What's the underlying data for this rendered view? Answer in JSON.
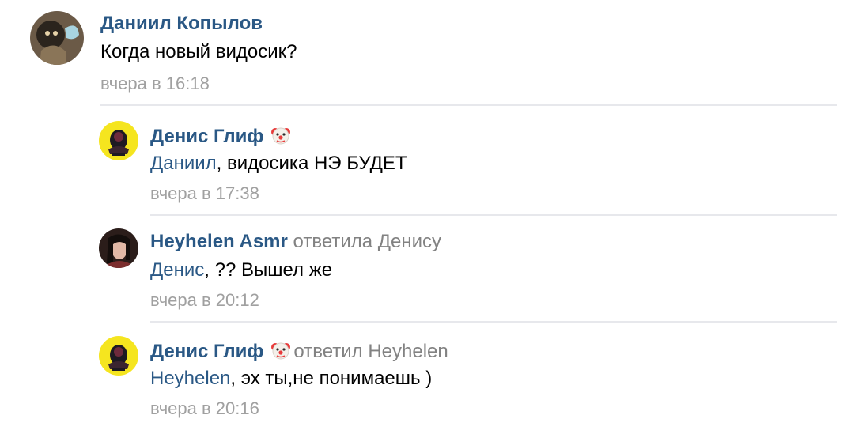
{
  "comments": [
    {
      "author": "Даниил Копылов",
      "reply_to": "",
      "mention": "",
      "text": "Когда новый видосик?",
      "date": "вчера в 16:18"
    },
    {
      "author": "Денис Глиф",
      "reply_to": "",
      "mention": "Даниил",
      "text": ", видосика НЭ БУДЕТ",
      "date": "вчера в 17:38"
    },
    {
      "author": "Heyhelen Asmr",
      "reply_to": "ответила Денису",
      "mention": "Денис",
      "text": ", ?? Вышел же",
      "date": "вчера в 20:12"
    },
    {
      "author": "Денис Глиф",
      "reply_to": "ответил Heyhelen",
      "mention": "Heyhelen",
      "text": ", эх ты,не понимаешь )",
      "date": "вчера в 20:16"
    }
  ],
  "icons": {
    "author_badge": "clown-face-emoji"
  },
  "colors": {
    "link": "#2a5885",
    "secondary": "#828282",
    "date": "#a0a0a0",
    "divider": "#e7e8ec"
  }
}
